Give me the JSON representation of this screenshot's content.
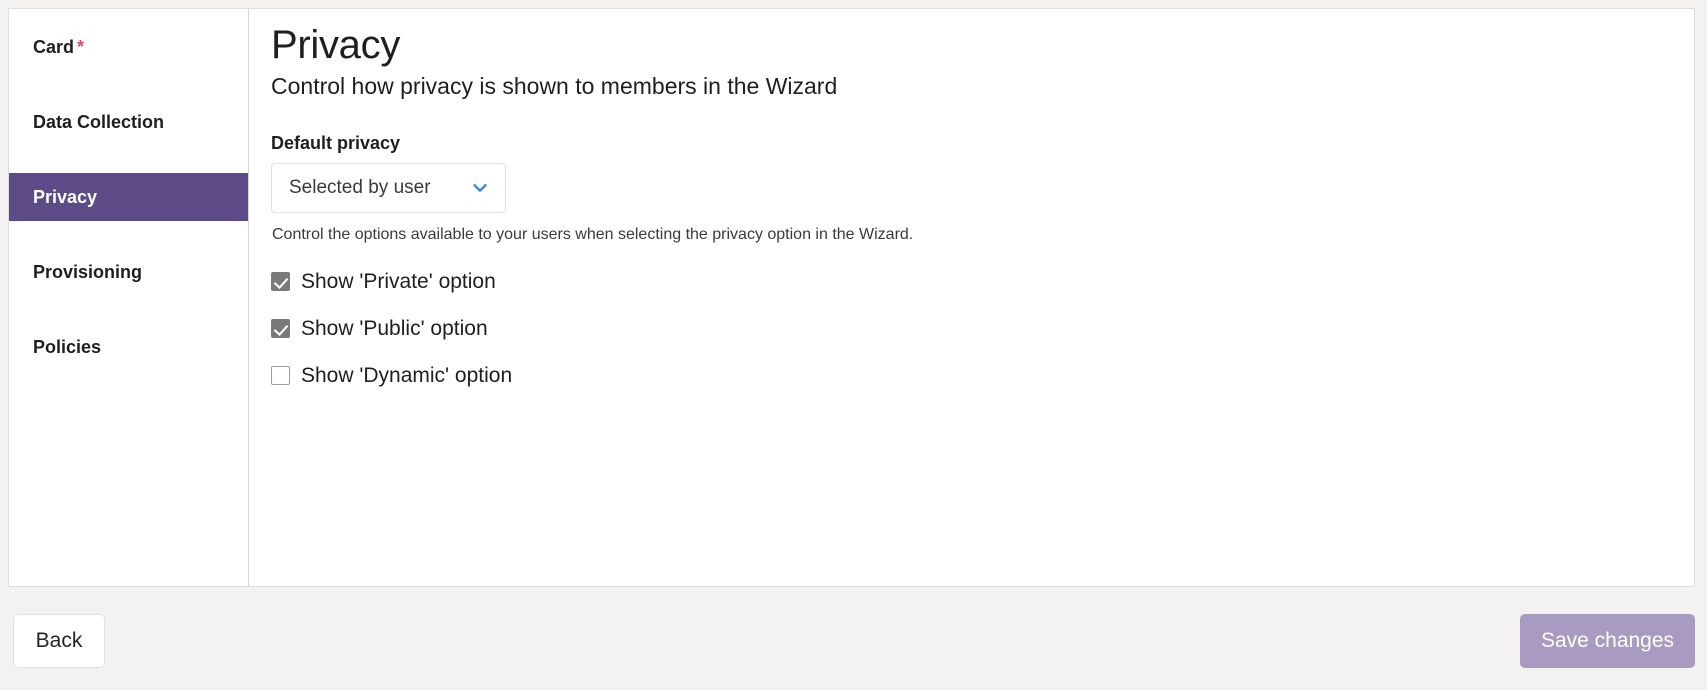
{
  "sidebar": {
    "items": [
      {
        "label": "Card",
        "required_marker": "*",
        "active": false
      },
      {
        "label": "Data Collection",
        "required_marker": "",
        "active": false
      },
      {
        "label": "Privacy",
        "required_marker": "",
        "active": true
      },
      {
        "label": "Provisioning",
        "required_marker": "",
        "active": false
      },
      {
        "label": "Policies",
        "required_marker": "",
        "active": false
      }
    ]
  },
  "content": {
    "title": "Privacy",
    "subtitle": "Control how privacy is shown to members in the Wizard",
    "default_privacy": {
      "label": "Default privacy",
      "selected_value": "Selected by user",
      "chevron_icon": "chevron-down-icon",
      "chevron_color": "#3a86d6"
    },
    "help_text": "Control the options available to your users when selecting the privacy option in the Wizard.",
    "checkboxes": [
      {
        "label": "Show 'Private' option",
        "checked": true
      },
      {
        "label": "Show 'Public' option",
        "checked": true
      },
      {
        "label": "Show 'Dynamic' option",
        "checked": false
      }
    ]
  },
  "footer": {
    "back_label": "Back",
    "save_label": "Save changes"
  },
  "colors": {
    "accent_purple": "#5d4b87",
    "save_button": "#a99ac1",
    "required_asterisk": "#e8486d",
    "page_background": "#f3f2f1"
  }
}
